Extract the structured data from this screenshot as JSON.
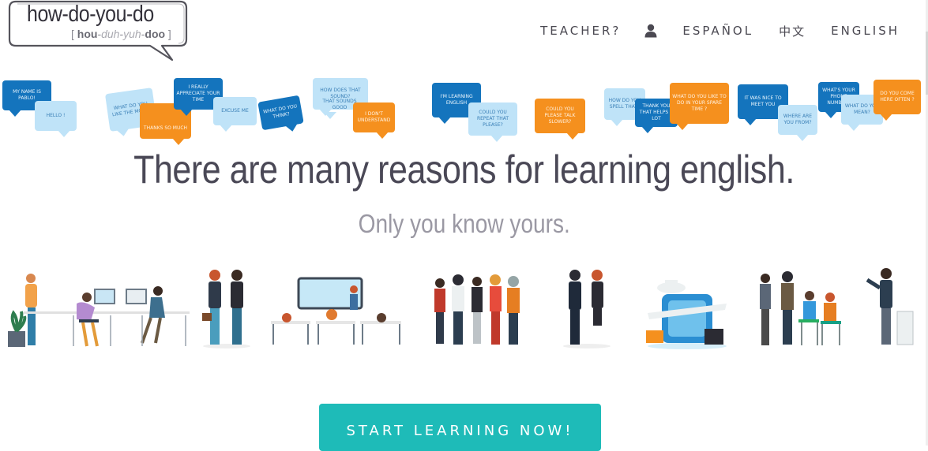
{
  "logo": {
    "main": "how-do-you-do",
    "sub_open": "[ ",
    "sub_hou": "hou",
    "sub_dash1": "-",
    "sub_duh": "duh",
    "sub_dash2": "-",
    "sub_yuh": "yuh",
    "sub_dash3": "-",
    "sub_doo": "doo",
    "sub_close": " ]"
  },
  "nav": {
    "teacher": "TEACHER?",
    "user_icon": "user-icon",
    "espanol": "ESPAÑOL",
    "chinese": "中文",
    "english": "ENGLISH"
  },
  "bubbles": [
    "MY NAME IS PABLO!",
    "HELLO !",
    "WHAT DO YOU LIKE THE MOST?",
    "THANKS SO MUCH",
    "I REALLY APPRECIATE YOUR TIME",
    "EXCUSE ME",
    "WHAT DO YOU THINK?",
    "HOW DOES THAT SOUND?",
    "THAT SOUNDS GOOD",
    "I DON'T UNDERSTAND",
    "I'M LEARNING ENGLISH",
    "COULD YOU REPEAT THAT PLEASE?",
    "COULD YOU PLEASE TALK SLOWER?",
    "HOW DO YOU SPELL THAT?",
    "THANK YOU THAT HELPS A LOT",
    "WHAT DO YOU LIKE TO DO IN YOUR SPARE TIME ?",
    "IT WAS NICE TO MEET YOU",
    "WHERE ARE YOU FROM?",
    "WHAT'S YOUR PHONE NUMBER?",
    "WHAT DO YOU MEAN?",
    "DO YOU COME HERE OFTEN ?"
  ],
  "headline": "There are many reasons for learning english.",
  "subheadline": "Only you know yours.",
  "cta": "START LEARNING NOW!",
  "colors": {
    "accent": "#1ebbb8",
    "bubble_dark": "#1474bd",
    "bubble_light": "#bfe3f8",
    "bubble_orange": "#f5901e",
    "headline": "#4a4856"
  }
}
